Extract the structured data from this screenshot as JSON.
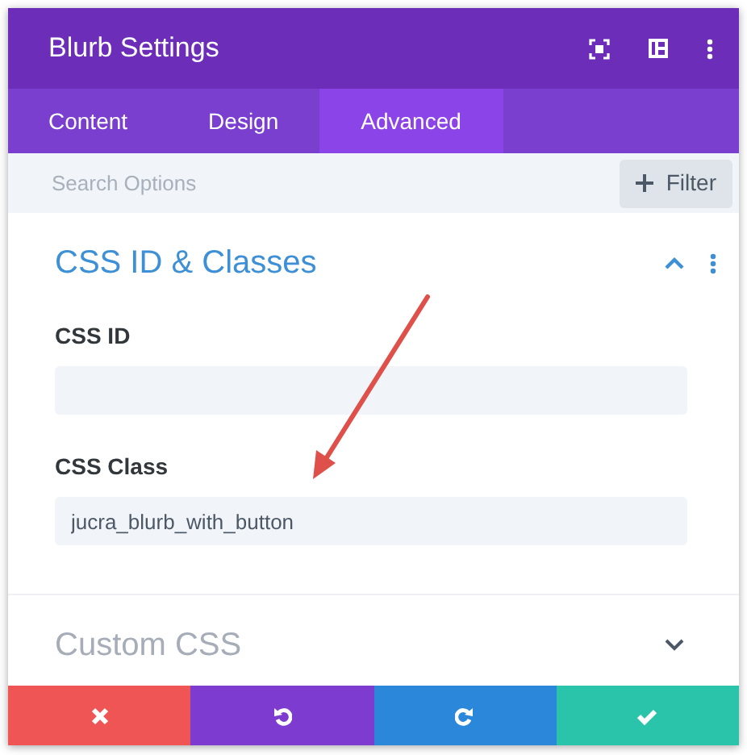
{
  "window": {
    "title": "Blurb Settings"
  },
  "tabs": [
    {
      "label": "Content",
      "selected": false
    },
    {
      "label": "Design",
      "selected": false
    },
    {
      "label": "Advanced",
      "selected": true
    }
  ],
  "search": {
    "placeholder": "Search Options"
  },
  "filter_button": {
    "label": "Filter"
  },
  "sections": [
    {
      "title": "CSS ID & Classes",
      "expanded": true,
      "fields": [
        {
          "label": "CSS ID"
        },
        {
          "label": "CSS Class",
          "value": "jucra_blurb_with_button"
        }
      ]
    },
    {
      "title": "Custom CSS",
      "expanded": false
    }
  ],
  "footer_buttons": [
    {
      "kind": "cancel",
      "color": "#ef5555"
    },
    {
      "kind": "undo",
      "color": "#7e3bd0"
    },
    {
      "kind": "redo",
      "color": "#2b87da"
    },
    {
      "kind": "save",
      "color": "#29c4a9"
    }
  ]
}
